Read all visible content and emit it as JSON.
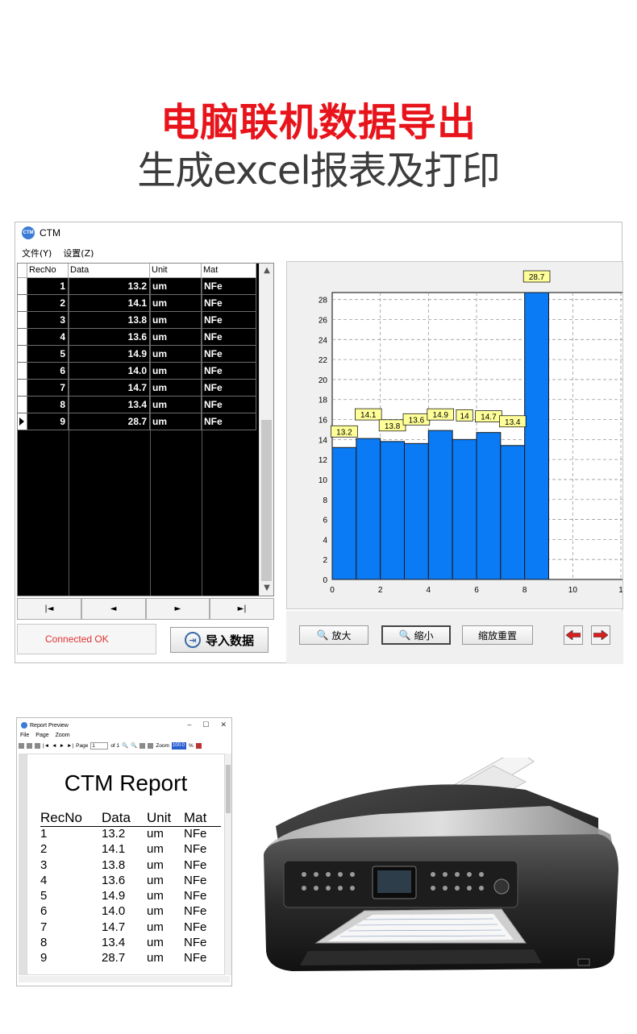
{
  "headline": {
    "line1": "电脑联机数据导出",
    "line2": "生成excel报表及打印"
  },
  "app": {
    "title": "CTM",
    "logo_text": "CTM",
    "menu": [
      "文件(Y)",
      "设置(Z)"
    ],
    "grid": {
      "headers": [
        "RecNo",
        "Data",
        "Unit",
        "Mat"
      ],
      "rows": [
        {
          "recno": "1",
          "data": "13.2",
          "unit": "um",
          "mat": "NFe"
        },
        {
          "recno": "2",
          "data": "14.1",
          "unit": "um",
          "mat": "NFe"
        },
        {
          "recno": "3",
          "data": "13.8",
          "unit": "um",
          "mat": "NFe"
        },
        {
          "recno": "4",
          "data": "13.6",
          "unit": "um",
          "mat": "NFe"
        },
        {
          "recno": "5",
          "data": "14.9",
          "unit": "um",
          "mat": "NFe"
        },
        {
          "recno": "6",
          "data": "14.0",
          "unit": "um",
          "mat": "NFe"
        },
        {
          "recno": "7",
          "data": "14.7",
          "unit": "um",
          "mat": "NFe"
        },
        {
          "recno": "8",
          "data": "13.4",
          "unit": "um",
          "mat": "NFe"
        },
        {
          "recno": "9",
          "data": "28.7",
          "unit": "um",
          "mat": "NFe"
        }
      ],
      "current_row": 9
    },
    "nav_buttons": [
      "|◄",
      "◄",
      "►",
      "►|"
    ],
    "status": "Connected OK",
    "import_button": "导入数据",
    "chart_buttons": {
      "zoom_in": "放大",
      "zoom_out": "缩小",
      "reset": "缩放重置"
    },
    "bar_color": "#0a7af5",
    "status_color": "#e03030"
  },
  "chart_data": {
    "type": "bar",
    "x": [
      1,
      2,
      3,
      4,
      5,
      6,
      7,
      8,
      9
    ],
    "values": [
      13.2,
      14.1,
      13.8,
      13.6,
      14.9,
      14.0,
      14.7,
      13.4,
      28.7
    ],
    "data_labels": [
      "13.2",
      "14.1",
      "13.8",
      "13.6",
      "14.9",
      "14",
      "14.7",
      "13.4",
      "28.7"
    ],
    "x_ticks": [
      "0",
      "2",
      "4",
      "6",
      "8",
      "10",
      "1"
    ],
    "y_ticks": [
      "0",
      "2",
      "4",
      "6",
      "8",
      "10",
      "12",
      "14",
      "16",
      "18",
      "20",
      "22",
      "24",
      "26",
      "28"
    ],
    "xlim": [
      0,
      12
    ],
    "ylim": [
      0,
      28.7
    ],
    "grid": true
  },
  "report_preview": {
    "window_title": "Report Preview",
    "menu": [
      "File",
      "Page",
      "Zoom"
    ],
    "toolbar": {
      "page_label": "Page",
      "page_value": "1",
      "of_label": "of 1",
      "zoom_label": "Zoom",
      "zoom_value": "100.0",
      "percent": "%"
    },
    "report_title": "CTM Report",
    "headers": [
      "RecNo",
      "Data",
      "Unit",
      "Mat"
    ],
    "rows": [
      [
        "1",
        "13.2",
        "um",
        "NFe"
      ],
      [
        "2",
        "14.1",
        "um",
        "NFe"
      ],
      [
        "3",
        "13.8",
        "um",
        "NFe"
      ],
      [
        "4",
        "13.6",
        "um",
        "NFe"
      ],
      [
        "5",
        "14.9",
        "um",
        "NFe"
      ],
      [
        "6",
        "14.0",
        "um",
        "NFe"
      ],
      [
        "7",
        "14.7",
        "um",
        "NFe"
      ],
      [
        "8",
        "13.4",
        "um",
        "NFe"
      ],
      [
        "9",
        "28.7",
        "um",
        "NFe"
      ]
    ]
  }
}
